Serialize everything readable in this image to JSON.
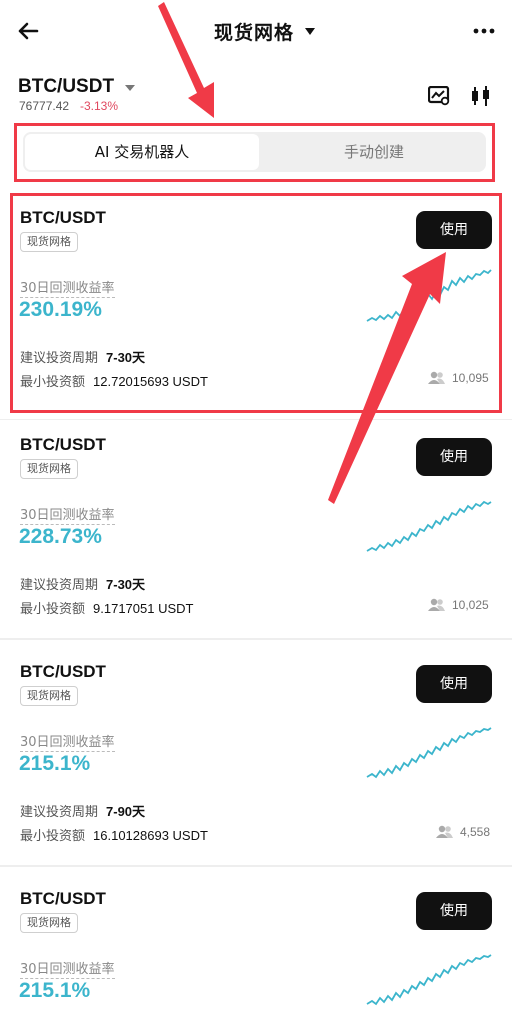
{
  "header": {
    "title": "现货网格",
    "back_icon": "arrow-left-icon",
    "more_icon": "more-horizontal-icon"
  },
  "market": {
    "pair": "BTC/USDT",
    "price": "76777.42",
    "change": "-3.13%",
    "change_color": "#e0485f",
    "icons": [
      "chart-icon",
      "candlestick-icon"
    ]
  },
  "tabs": [
    {
      "label": "AI 交易机器人",
      "active": true
    },
    {
      "label": "手动创建",
      "active": false
    }
  ],
  "labels": {
    "return_label": "30日回测收益率",
    "period_label": "建议投资周期",
    "min_label": "最小投资额"
  },
  "bots": [
    {
      "pair": "BTC/USDT",
      "tag": "现货网格",
      "button": "使用",
      "return": "230.19%",
      "period": "7-30天",
      "min_invest": "12.72015693 USDT",
      "users": "10,095"
    },
    {
      "pair": "BTC/USDT",
      "tag": "现货网格",
      "button": "使用",
      "return": "228.73%",
      "period": "7-30天",
      "min_invest": "9.1717051 USDT",
      "users": "10,025"
    },
    {
      "pair": "BTC/USDT",
      "tag": "现货网格",
      "button": "使用",
      "return": "215.1%",
      "period": "7-90天",
      "min_invest": "16.10128693 USDT",
      "users": "4,558"
    },
    {
      "pair": "BTC/USDT",
      "tag": "现货网格",
      "button": "使用",
      "return": "215.1%"
    }
  ],
  "colors": {
    "accent_return": "#3cb5cc",
    "annotation": "#f03a47",
    "button_bg": "#111111"
  }
}
